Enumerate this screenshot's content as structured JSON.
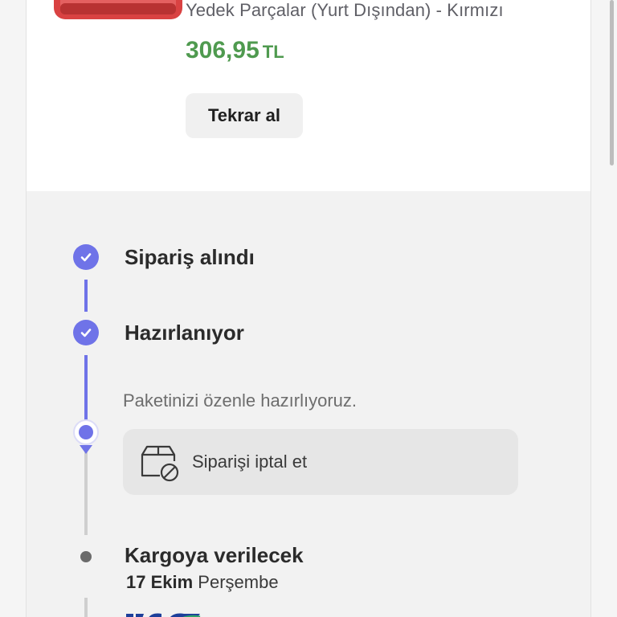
{
  "product": {
    "title": "Yedek Parçalar (Yurt Dışından) - Kırmızı",
    "price_amount": "306,95",
    "price_currency": "TL",
    "rebuy_label": "Tekrar al"
  },
  "timeline": {
    "steps": [
      {
        "label": "Sipariş alındı",
        "status": "done"
      },
      {
        "label": "Hazırlanıyor",
        "status": "done"
      },
      {
        "label": "Kargoya verilecek",
        "status": "pending"
      }
    ],
    "current_description": "Paketinizi özenle hazırlıyoruz.",
    "cancel_label": "Siparişi iptal et",
    "shipping_date_day": "17 Ekim",
    "shipping_date_weekday": "Perşembe"
  },
  "colors": {
    "accent": "#6f73e8",
    "price": "#4f9a4f",
    "product_thumb": "#d94242"
  },
  "icons": {
    "check": "check-icon",
    "cancel": "box-cancel-icon"
  }
}
